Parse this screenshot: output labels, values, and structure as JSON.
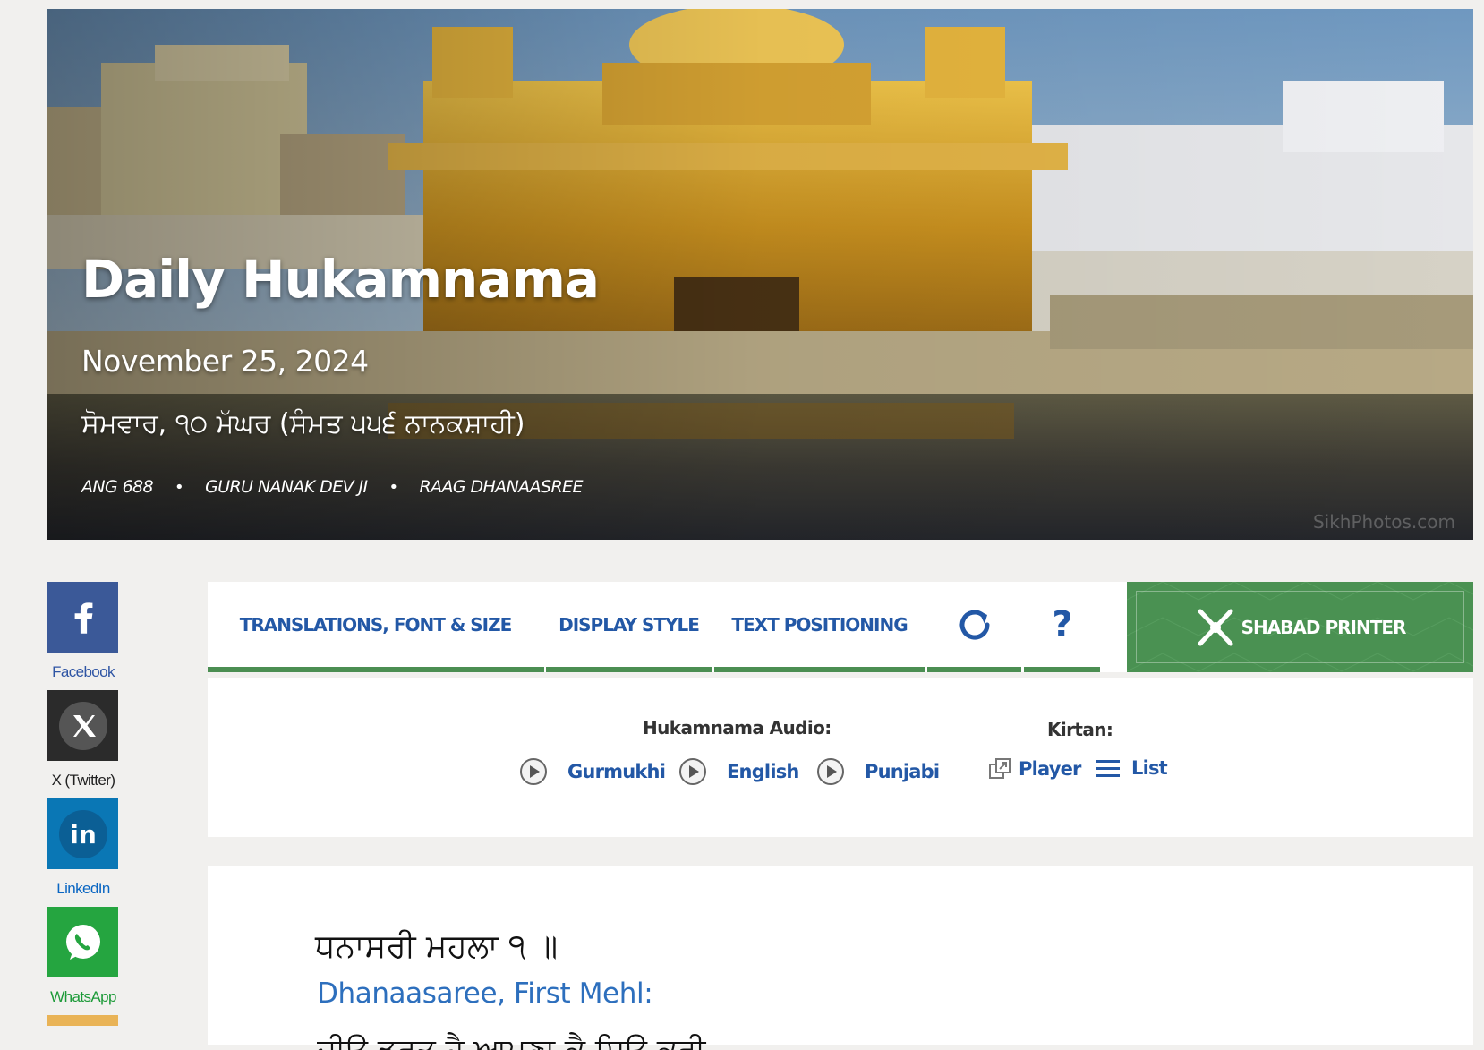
{
  "hero": {
    "title": "Daily Hukamnama",
    "date": "November 25, 2024",
    "gurmukhi_date": "ਸੋਮਵਾਰ, ੧੦ ਮੱਘਰ (ਸੰਮਤ ੫੫੬ ਨਾਨਕਸ਼ਾਹੀ)",
    "meta": [
      "ANG 688",
      "GURU NANAK DEV JI",
      "RAAG DHANAASREE"
    ],
    "watermark": "SikhPhotos.com"
  },
  "social": [
    {
      "label": "Facebook",
      "icon": "facebook-icon"
    },
    {
      "label": "X (Twitter)",
      "icon": "x-twitter-icon"
    },
    {
      "label": "LinkedIn",
      "icon": "linkedin-icon"
    },
    {
      "label": "WhatsApp",
      "icon": "whatsapp-icon"
    }
  ],
  "toolbar": {
    "tabs": [
      "TRANSLATIONS, FONT & SIZE",
      "DISPLAY STYLE",
      "TEXT POSITIONING"
    ],
    "refresh_icon": "refresh-icon",
    "help_label": "?",
    "printer_label": "SHABAD PRINTER",
    "accent": "#4a9152",
    "link_color": "#2358a6"
  },
  "audio": {
    "hukamnama_label": "Hukamnama Audio:",
    "languages": [
      "Gurmukhi",
      "English",
      "Punjabi"
    ],
    "kirtan_label": "Kirtan:",
    "player_label": "Player",
    "list_label": "List"
  },
  "content": {
    "gurbani": "ਧਨਾਸਰੀ ਮਹਲਾ ੧ ॥",
    "translation": "Dhanaasaree, First Mehl:",
    "next_line": "ਜੀਉ ਡਰਤੁ ਹੈ ਆਪਣਾ ਕੈ ਸਿਉ ਕਰੀ ਪੁਕਾਰ ॥"
  }
}
